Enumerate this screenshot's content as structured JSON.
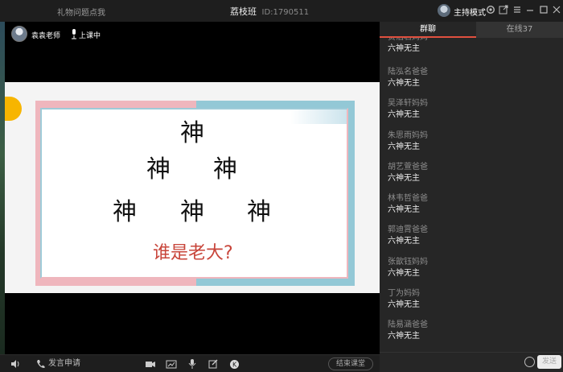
{
  "titlebar": {
    "gift_link": "礼物问题点我",
    "class_name": "荔枝班",
    "class_id": "ID:1790511",
    "host_mode": "主持模式",
    "icons": [
      "settings-icon",
      "popout-icon",
      "menu-icon",
      "minimize-icon",
      "maximize-icon",
      "close-icon"
    ]
  },
  "stage": {
    "teacher_name": "袁袁老师",
    "status": "上课中",
    "slide": {
      "row1": [
        "神"
      ],
      "row2": [
        "神",
        "神"
      ],
      "row3": [
        "神",
        "神",
        "神"
      ],
      "question": "谁是老大?"
    }
  },
  "bottombar": {
    "speak_request": "发言申请",
    "end_class": "结束课堂"
  },
  "chat": {
    "tab_group": "群聊",
    "tab_online": "在线37",
    "messages": [
      {
        "who": "贺泊君妈妈",
        "text": "六神无主"
      },
      {
        "who": "陆泓名爸爸",
        "text": "六神无主"
      },
      {
        "who": "吴泽轩妈妈",
        "text": "六神无主"
      },
      {
        "who": "朱思雨妈妈",
        "text": "六神无主"
      },
      {
        "who": "胡艺萱爸爸",
        "text": "六神无主"
      },
      {
        "who": "林韦哲爸爸",
        "text": "六神无主"
      },
      {
        "who": "郭迪霄爸爸",
        "text": "六神无主"
      },
      {
        "who": "张歆钰妈妈",
        "text": "六神无主"
      },
      {
        "who": "丁为妈妈",
        "text": "六神无主"
      },
      {
        "who": "陆易涵爸爸",
        "text": "六神无主"
      }
    ],
    "send_label": "发送"
  }
}
